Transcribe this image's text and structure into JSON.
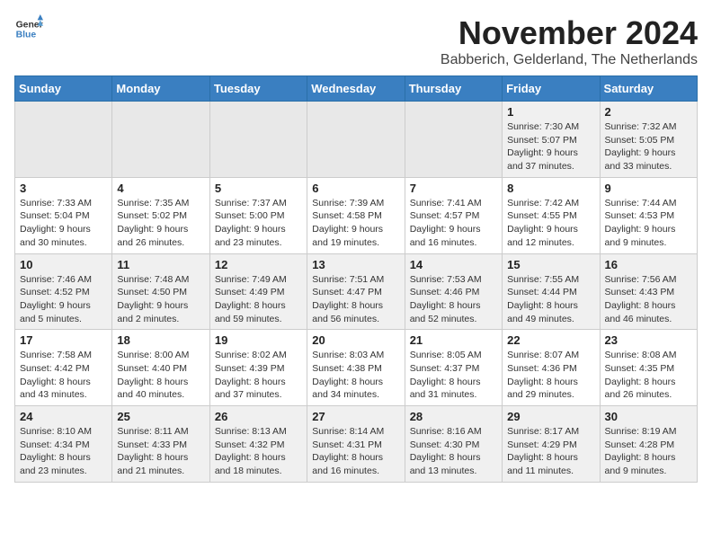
{
  "header": {
    "logo_general": "General",
    "logo_blue": "Blue",
    "month_title": "November 2024",
    "location": "Babberich, Gelderland, The Netherlands"
  },
  "weekdays": [
    "Sunday",
    "Monday",
    "Tuesday",
    "Wednesday",
    "Thursday",
    "Friday",
    "Saturday"
  ],
  "weeks": [
    [
      {
        "day": "",
        "info": ""
      },
      {
        "day": "",
        "info": ""
      },
      {
        "day": "",
        "info": ""
      },
      {
        "day": "",
        "info": ""
      },
      {
        "day": "",
        "info": ""
      },
      {
        "day": "1",
        "info": "Sunrise: 7:30 AM\nSunset: 5:07 PM\nDaylight: 9 hours and 37 minutes."
      },
      {
        "day": "2",
        "info": "Sunrise: 7:32 AM\nSunset: 5:05 PM\nDaylight: 9 hours and 33 minutes."
      }
    ],
    [
      {
        "day": "3",
        "info": "Sunrise: 7:33 AM\nSunset: 5:04 PM\nDaylight: 9 hours and 30 minutes."
      },
      {
        "day": "4",
        "info": "Sunrise: 7:35 AM\nSunset: 5:02 PM\nDaylight: 9 hours and 26 minutes."
      },
      {
        "day": "5",
        "info": "Sunrise: 7:37 AM\nSunset: 5:00 PM\nDaylight: 9 hours and 23 minutes."
      },
      {
        "day": "6",
        "info": "Sunrise: 7:39 AM\nSunset: 4:58 PM\nDaylight: 9 hours and 19 minutes."
      },
      {
        "day": "7",
        "info": "Sunrise: 7:41 AM\nSunset: 4:57 PM\nDaylight: 9 hours and 16 minutes."
      },
      {
        "day": "8",
        "info": "Sunrise: 7:42 AM\nSunset: 4:55 PM\nDaylight: 9 hours and 12 minutes."
      },
      {
        "day": "9",
        "info": "Sunrise: 7:44 AM\nSunset: 4:53 PM\nDaylight: 9 hours and 9 minutes."
      }
    ],
    [
      {
        "day": "10",
        "info": "Sunrise: 7:46 AM\nSunset: 4:52 PM\nDaylight: 9 hours and 5 minutes."
      },
      {
        "day": "11",
        "info": "Sunrise: 7:48 AM\nSunset: 4:50 PM\nDaylight: 9 hours and 2 minutes."
      },
      {
        "day": "12",
        "info": "Sunrise: 7:49 AM\nSunset: 4:49 PM\nDaylight: 8 hours and 59 minutes."
      },
      {
        "day": "13",
        "info": "Sunrise: 7:51 AM\nSunset: 4:47 PM\nDaylight: 8 hours and 56 minutes."
      },
      {
        "day": "14",
        "info": "Sunrise: 7:53 AM\nSunset: 4:46 PM\nDaylight: 8 hours and 52 minutes."
      },
      {
        "day": "15",
        "info": "Sunrise: 7:55 AM\nSunset: 4:44 PM\nDaylight: 8 hours and 49 minutes."
      },
      {
        "day": "16",
        "info": "Sunrise: 7:56 AM\nSunset: 4:43 PM\nDaylight: 8 hours and 46 minutes."
      }
    ],
    [
      {
        "day": "17",
        "info": "Sunrise: 7:58 AM\nSunset: 4:42 PM\nDaylight: 8 hours and 43 minutes."
      },
      {
        "day": "18",
        "info": "Sunrise: 8:00 AM\nSunset: 4:40 PM\nDaylight: 8 hours and 40 minutes."
      },
      {
        "day": "19",
        "info": "Sunrise: 8:02 AM\nSunset: 4:39 PM\nDaylight: 8 hours and 37 minutes."
      },
      {
        "day": "20",
        "info": "Sunrise: 8:03 AM\nSunset: 4:38 PM\nDaylight: 8 hours and 34 minutes."
      },
      {
        "day": "21",
        "info": "Sunrise: 8:05 AM\nSunset: 4:37 PM\nDaylight: 8 hours and 31 minutes."
      },
      {
        "day": "22",
        "info": "Sunrise: 8:07 AM\nSunset: 4:36 PM\nDaylight: 8 hours and 29 minutes."
      },
      {
        "day": "23",
        "info": "Sunrise: 8:08 AM\nSunset: 4:35 PM\nDaylight: 8 hours and 26 minutes."
      }
    ],
    [
      {
        "day": "24",
        "info": "Sunrise: 8:10 AM\nSunset: 4:34 PM\nDaylight: 8 hours and 23 minutes."
      },
      {
        "day": "25",
        "info": "Sunrise: 8:11 AM\nSunset: 4:33 PM\nDaylight: 8 hours and 21 minutes."
      },
      {
        "day": "26",
        "info": "Sunrise: 8:13 AM\nSunset: 4:32 PM\nDaylight: 8 hours and 18 minutes."
      },
      {
        "day": "27",
        "info": "Sunrise: 8:14 AM\nSunset: 4:31 PM\nDaylight: 8 hours and 16 minutes."
      },
      {
        "day": "28",
        "info": "Sunrise: 8:16 AM\nSunset: 4:30 PM\nDaylight: 8 hours and 13 minutes."
      },
      {
        "day": "29",
        "info": "Sunrise: 8:17 AM\nSunset: 4:29 PM\nDaylight: 8 hours and 11 minutes."
      },
      {
        "day": "30",
        "info": "Sunrise: 8:19 AM\nSunset: 4:28 PM\nDaylight: 8 hours and 9 minutes."
      }
    ]
  ]
}
